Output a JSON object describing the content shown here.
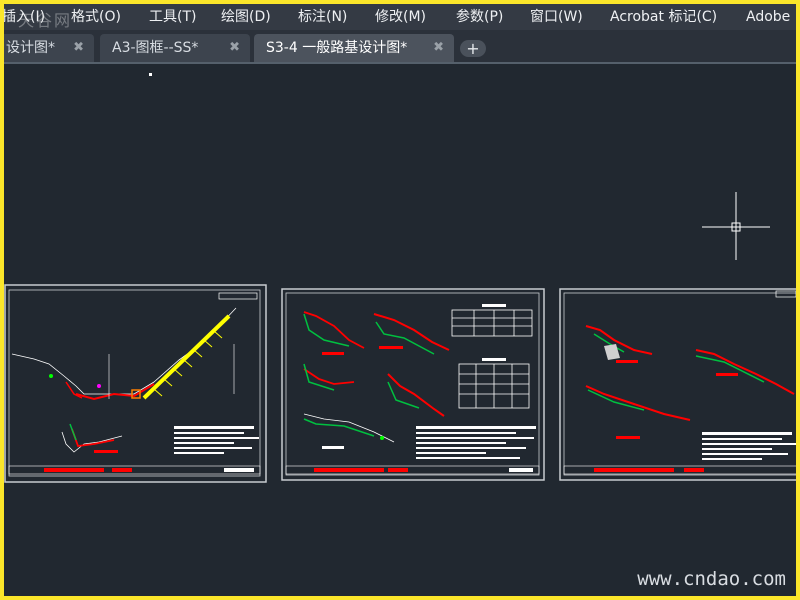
{
  "menubar": {
    "items": [
      {
        "label": "插入(I)"
      },
      {
        "label": "格式(O)"
      },
      {
        "label": "工具(T)"
      },
      {
        "label": "绘图(D)"
      },
      {
        "label": "标注(N)"
      },
      {
        "label": "修改(M)"
      },
      {
        "label": "参数(P)"
      },
      {
        "label": "窗口(W)"
      },
      {
        "label": "Acrobat 标记(C)"
      },
      {
        "label": "Adobe"
      }
    ]
  },
  "watermark_top": "天谷网",
  "tabs": [
    {
      "label": "设计图*",
      "close_icon": "close-icon",
      "active": false
    },
    {
      "label": "A3-图框--SS*",
      "close_icon": "close-icon",
      "active": false
    },
    {
      "label": "S3-4 一般路基设计图*",
      "close_icon": "close-icon",
      "active": true
    }
  ],
  "add_tab_icon": "plus-icon",
  "cursor_icon": "crosshair-cursor-icon",
  "watermark_bottom": "www.cndao.com",
  "colors": {
    "canvas_background": "#212830",
    "menubar_background": "#343a44",
    "frame_border": "#fbe62a",
    "drawing_red": "#ff0000",
    "drawing_green": "#00c040",
    "drawing_yellow": "#ffff00",
    "drawing_white": "#ffffff"
  }
}
